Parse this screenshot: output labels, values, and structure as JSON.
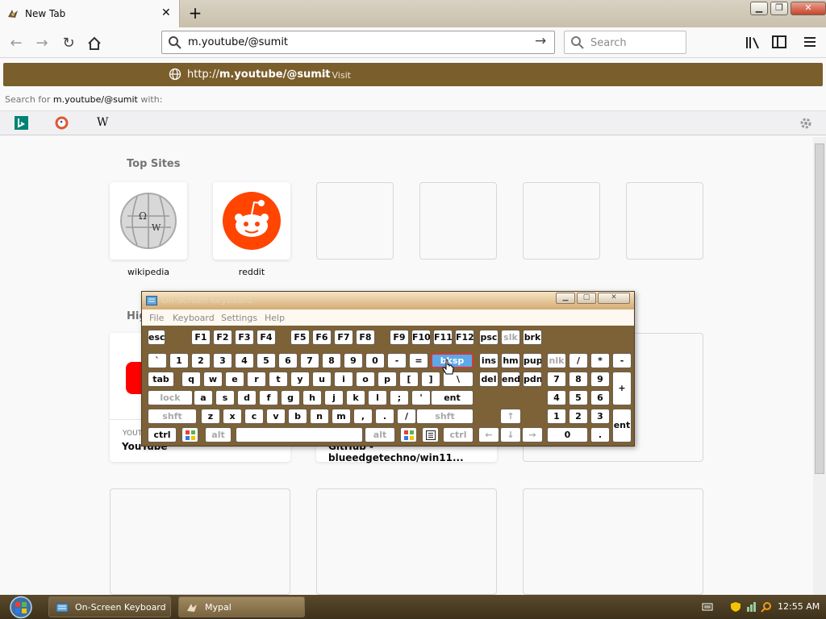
{
  "browser": {
    "tab": {
      "title": "New Tab"
    },
    "url_value": "m.youtube/@sumit",
    "search_placeholder": "Search",
    "suggestion": {
      "prefix": "http://",
      "bold": "m.youtube/@sumit",
      "visit": "— Visit"
    },
    "search_for": {
      "prefix": "Search for ",
      "query": "m.youtube/@sumit",
      "suffix": " with:"
    },
    "engines": [
      "bing-icon",
      "duckduckgo-icon",
      "wikipedia-icon"
    ],
    "accent": "#7a5e2c"
  },
  "newtab": {
    "top_sites_heading": "Top Sites",
    "top_sites": [
      {
        "label": "wikipedia",
        "icon": "wikipedia-globe-icon"
      },
      {
        "label": "reddit",
        "icon": "reddit-icon"
      },
      {
        "label": ""
      },
      {
        "label": ""
      },
      {
        "label": ""
      },
      {
        "label": ""
      }
    ],
    "highlights_heading": "Hig",
    "highlights": [
      {
        "source": "YOUT",
        "title": "YouTube"
      },
      {
        "source": "",
        "title": "GitHub - blueedgetechno/win11..."
      }
    ]
  },
  "osk": {
    "title": "On-Screen Keyboard",
    "menu": [
      "File",
      "Keyboard",
      "Settings",
      "Help"
    ],
    "rows": [
      [
        "esc",
        "F1",
        "F2",
        "F3",
        "F4",
        "F5",
        "F6",
        "F7",
        "F8",
        "F9",
        "F10",
        "F11",
        "F12",
        "psc",
        "slk",
        "brk"
      ],
      [
        "`",
        "1",
        "2",
        "3",
        "4",
        "5",
        "6",
        "7",
        "8",
        "9",
        "0",
        "-",
        "=",
        "bksp",
        "ins",
        "hm",
        "pup"
      ],
      [
        "tab",
        "q",
        "w",
        "e",
        "r",
        "t",
        "y",
        "u",
        "i",
        "o",
        "p",
        "[",
        "]",
        "\\",
        "del",
        "end",
        "pdn"
      ],
      [
        "lock",
        "a",
        "s",
        "d",
        "f",
        "g",
        "h",
        "j",
        "k",
        "l",
        ";",
        "'",
        "ent"
      ],
      [
        "shft",
        "z",
        "x",
        "c",
        "v",
        "b",
        "n",
        "m",
        ",",
        ".",
        "/",
        "shft"
      ],
      [
        "ctrl",
        "alt",
        "alt",
        "ctrl"
      ]
    ],
    "numpad": {
      "row1": [
        "nlk",
        "/",
        "*",
        "-"
      ],
      "row2": [
        "7",
        "8",
        "9"
      ],
      "row3": [
        "4",
        "5",
        "6"
      ],
      "row4": [
        "1",
        "2",
        "3"
      ],
      "plus": "+",
      "zero": "0",
      "dot": ".",
      "enter": "ent"
    },
    "highlighted_key": "bksp",
    "background": "#7d6137"
  },
  "taskbar": {
    "items": [
      {
        "label": "On-Screen Keyboard"
      },
      {
        "label": "Mypal"
      }
    ],
    "clock": "12:55 AM"
  }
}
